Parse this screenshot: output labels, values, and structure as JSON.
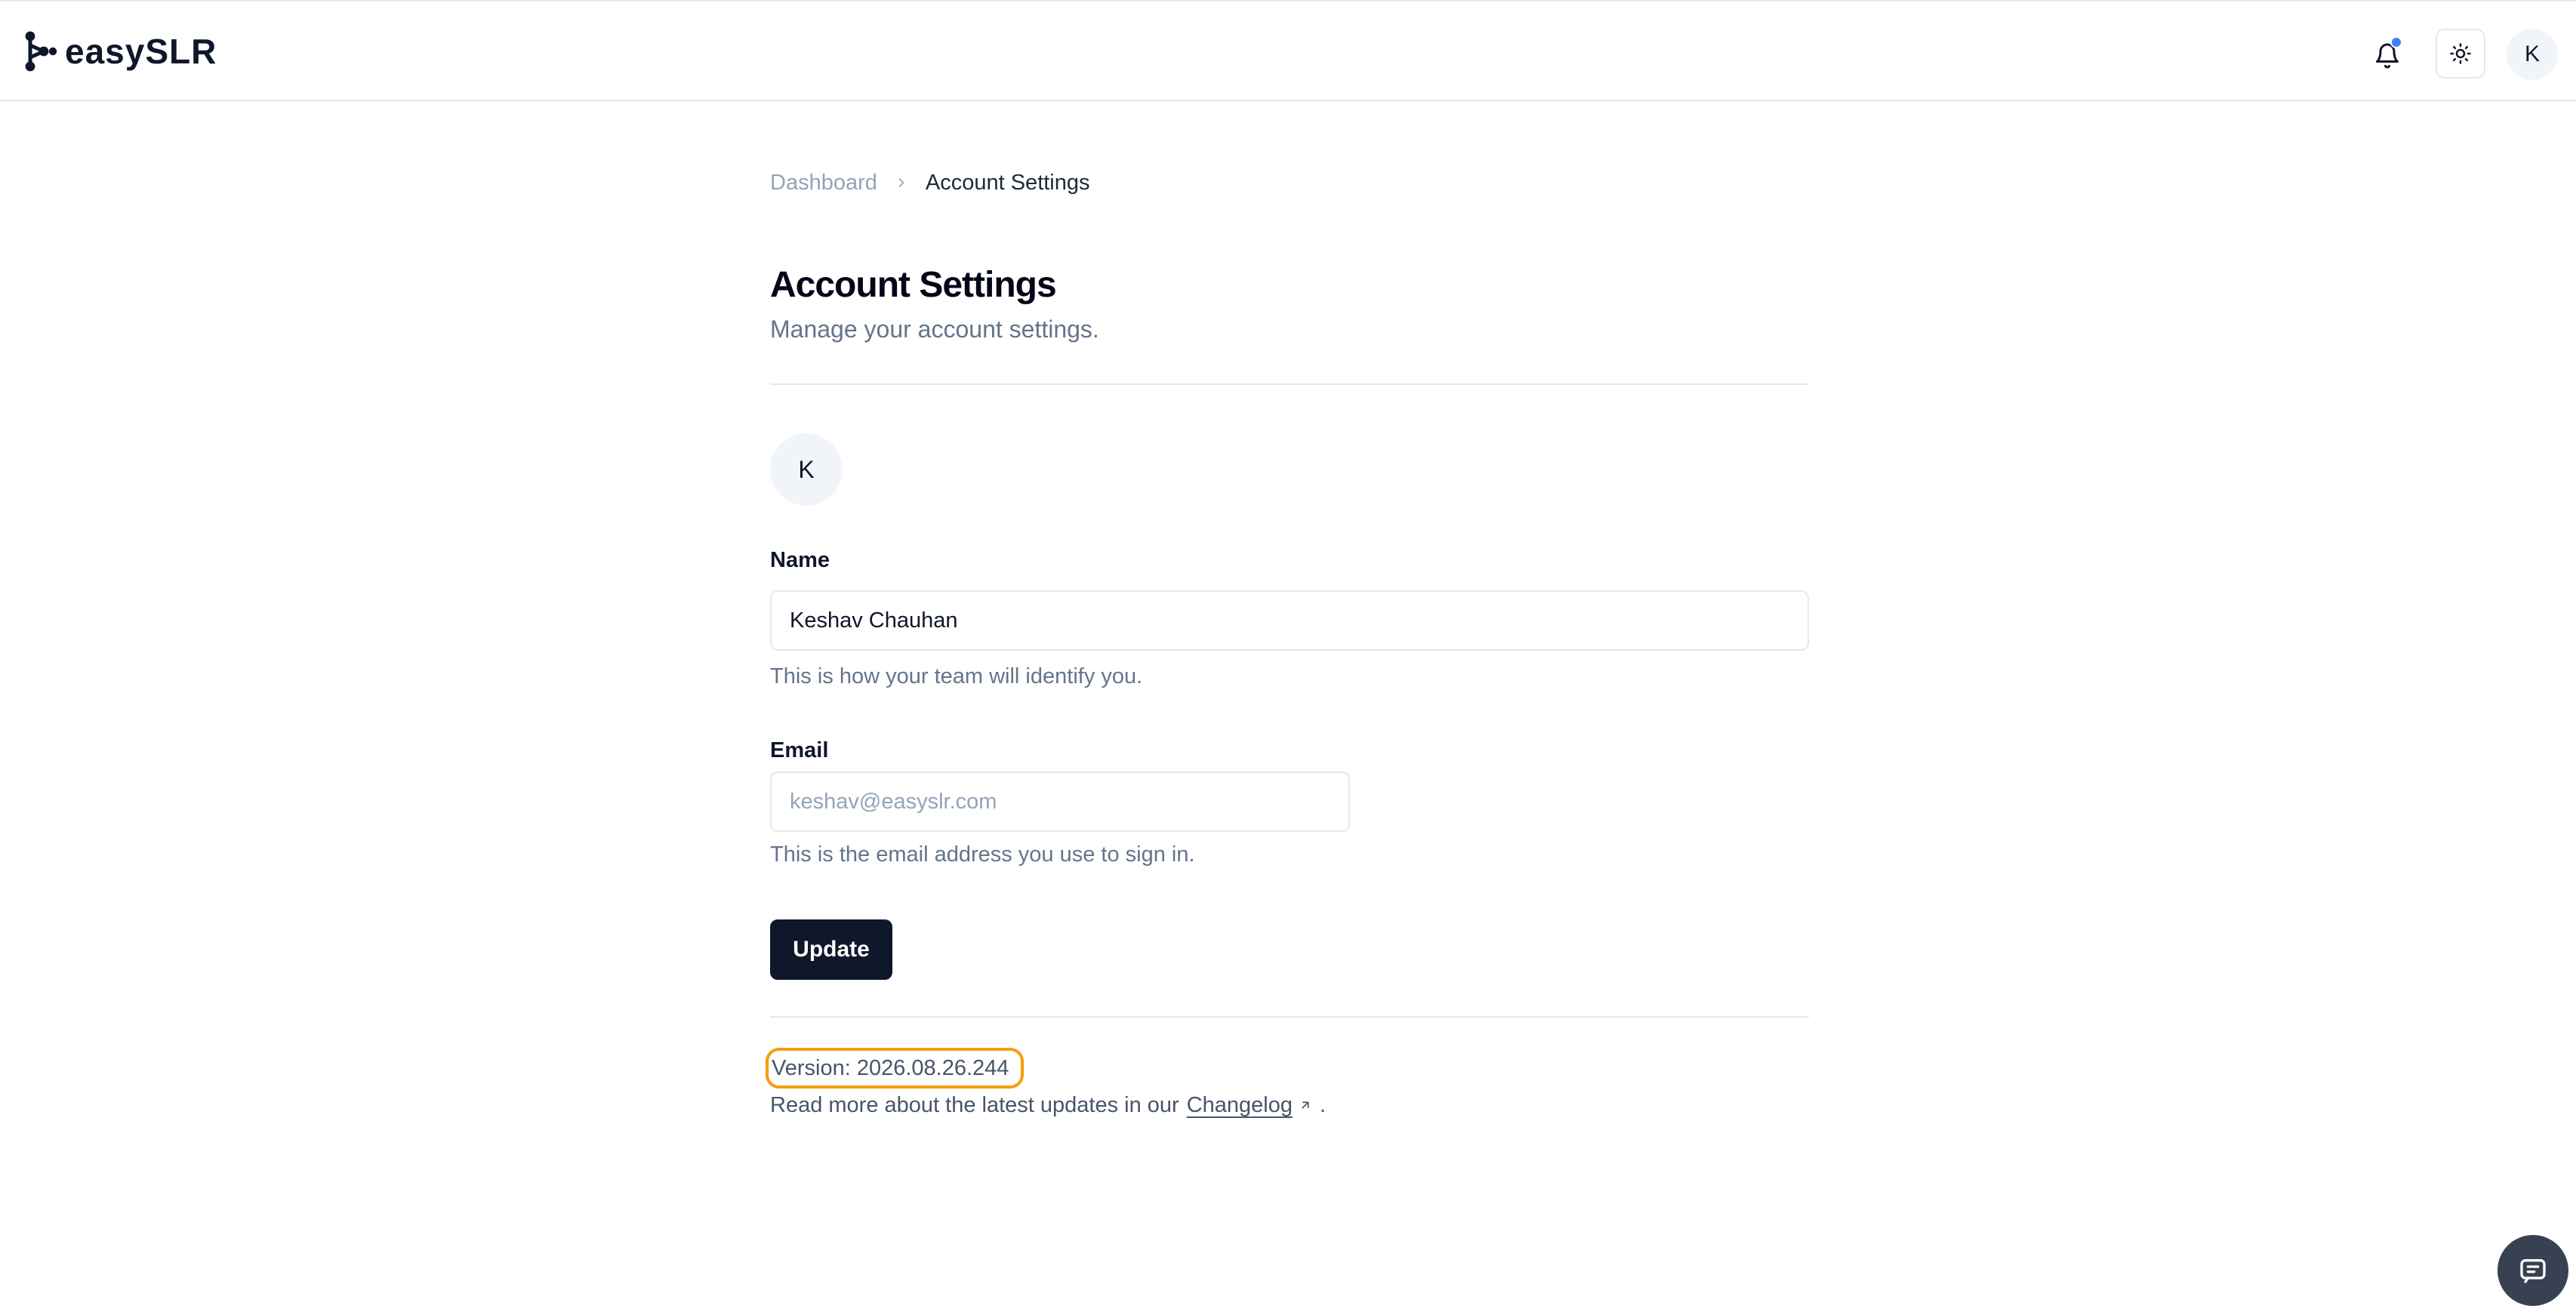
{
  "header": {
    "logo_text": "easySLR",
    "bell_icon": "bell-icon",
    "theme_icon": "sun-icon",
    "avatar_initial": "K",
    "notification_color": "#3b82f6"
  },
  "breadcrumb": {
    "items": [
      "Dashboard",
      "Account Settings"
    ]
  },
  "page": {
    "title": "Account Settings",
    "subtitle": "Manage your account settings."
  },
  "profile": {
    "avatar_initial": "K"
  },
  "form": {
    "name_label": "Name",
    "name_value": "Keshav Chauhan",
    "name_help": "This is how your team will identify you.",
    "email_label": "Email",
    "email_placeholder": "keshav@easyslr.com",
    "email_help": "This is the email address you use to sign in.",
    "update_label": "Update"
  },
  "footer": {
    "version": "Version: 2026.08.26.244",
    "changelog_prefix": "Read more about the latest updates in our",
    "changelog_link": "Changelog",
    "changelog_suffix": "."
  },
  "colors": {
    "primary": "#0f172a",
    "highlight": "#f59e0b",
    "muted": "#64748b"
  },
  "chat": {
    "icon": "chat-icon"
  }
}
